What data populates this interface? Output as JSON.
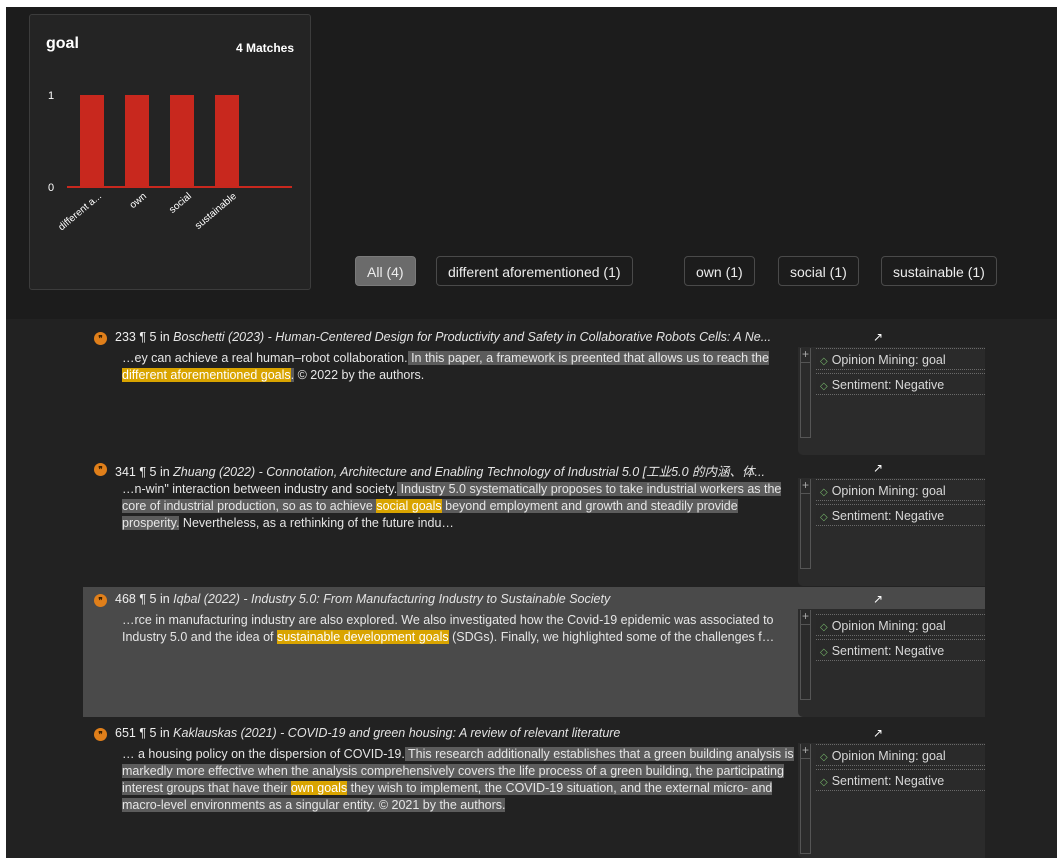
{
  "chart_card": {
    "title": "goal",
    "matches": "4 Matches"
  },
  "chart_data": {
    "type": "bar",
    "categories": [
      "different a...",
      "own",
      "social",
      "sustainable"
    ],
    "values": [
      1,
      1,
      1,
      1
    ],
    "ylim": [
      0,
      1
    ],
    "yticks": [
      "0",
      "1"
    ],
    "bar_color": "#c8281e"
  },
  "filters": [
    {
      "label": "All (4)",
      "active": true
    },
    {
      "label": "different aforementioned (1)",
      "active": false
    },
    {
      "label": "own (1)",
      "active": false
    },
    {
      "label": "social (1)",
      "active": false
    },
    {
      "label": "sustainable (1)",
      "active": false
    }
  ],
  "results": [
    {
      "num": "233",
      "para": "¶ 5 in",
      "source": "Boschetti (2023) - Human-Centered Design for Productivity and Safety in Collaborative Robots Cells: A Ne...",
      "pre": "…ey can achieve a real human–robot collaboration.",
      "hl_a": " In this paper, a framework is preented that allows us to reach the ",
      "match": "different aforementioned goals",
      "hl_b": ".",
      "post": " © 2022 by the authors.",
      "tag1": "Opinion Mining: goal",
      "tag2": "Sentiment: Negative"
    },
    {
      "num": "341",
      "para": "¶ 5 in",
      "source": "Zhuang (2022) - Connotation, Architecture and Enabling Technology of Industrial 5.0 [工业5.0 的内涵、体...",
      "pre": "…n-win\" interaction between industry and society.",
      "hl_a": " Industry 5.0 systematically proposes to take industrial workers as the core of industrial production, so as to achieve ",
      "match": "social goals",
      "hl_b": " beyond employment and growth and steadily provide prosperity.",
      "post": " Nevertheless, as a rethinking of the future indu…",
      "tag1": "Opinion Mining: goal",
      "tag2": "Sentiment: Negative"
    },
    {
      "num": "468",
      "para": "¶ 5 in",
      "source": "Iqbal (2022) - Industry 5.0: From Manufacturing Industry to Sustainable Society",
      "pre": "…rce in manufacturing industry are also explored. We also investigated how the Covid-19 epidemic was associated to Industry 5.0 and the idea of ",
      "hl_a": "",
      "match": "sustainable development goals",
      "hl_b": "",
      "post": " (SDGs). Finally, we highlighted some of the challenges f…",
      "tag1": "Opinion Mining: goal",
      "tag2": "Sentiment: Negative"
    },
    {
      "num": "651",
      "para": "¶ 5 in",
      "source": "Kaklauskas (2021) - COVID-19 and green housing: A review of relevant literature",
      "pre": "… a housing policy on the dispersion of COVID-19.",
      "hl_a": " This research additionally establishes that a green building analysis is markedly more effective when the analysis comprehensively covers the life process of a green building, the participating interest groups that have their ",
      "match": "own goals",
      "hl_b": " they wish to implement, the COVID-19 situation, and the external micro- and macro-level environments as a singular entity. © 2021 by the authors.",
      "post": "",
      "tag1": "Opinion Mining: goal",
      "tag2": "Sentiment: Negative"
    }
  ],
  "icons": {
    "bullet": "quote-bubble-icon",
    "open": "open-external-icon",
    "tag": "diamond-icon",
    "expand": "plus-icon"
  }
}
